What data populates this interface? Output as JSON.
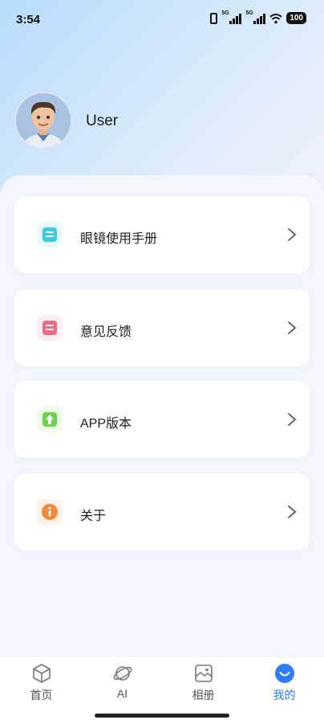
{
  "status_bar": {
    "time": "3:54",
    "signal_tag_1": "5G",
    "signal_tag_2": "5G",
    "battery": "100"
  },
  "profile": {
    "username": "User"
  },
  "menu": {
    "items": [
      {
        "label": "眼镜使用手册",
        "icon": "manual-icon",
        "color": "#3ec9e6"
      },
      {
        "label": "意见反馈",
        "icon": "feedback-icon",
        "color": "#f06b82"
      },
      {
        "label": "APP版本",
        "icon": "version-icon",
        "color": "#6cd24c"
      },
      {
        "label": "关于",
        "icon": "info-icon",
        "color": "#f08a3a"
      }
    ]
  },
  "tabbar": {
    "tabs": [
      {
        "label": "首页",
        "icon": "cube-icon"
      },
      {
        "label": "AI",
        "icon": "planet-icon"
      },
      {
        "label": "相册",
        "icon": "album-icon"
      },
      {
        "label": "我的",
        "icon": "smile-icon",
        "active": true
      }
    ],
    "active_color": "#2f7df6"
  }
}
